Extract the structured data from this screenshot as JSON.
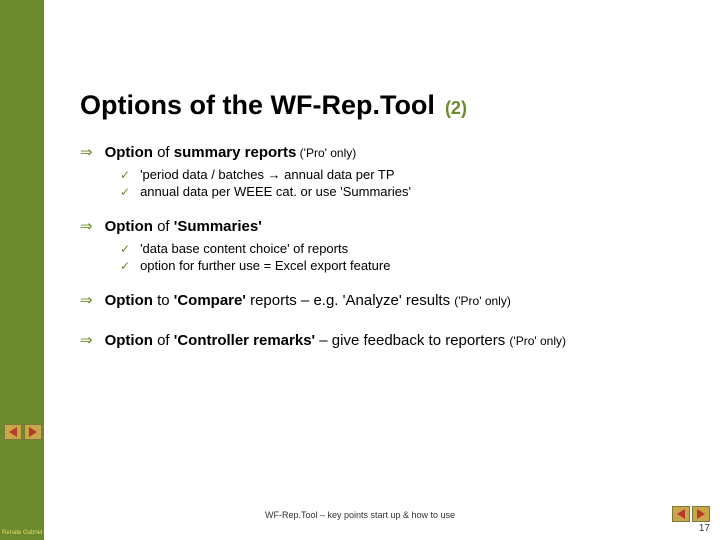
{
  "sidebar": {
    "author": "Renate Gabriel"
  },
  "title": {
    "main": "Options of the WF-Rep.Tool",
    "num": "(2)"
  },
  "bullets": {
    "b1": {
      "lead": "Option",
      "mid": " of ",
      "bold2": "summary reports",
      "tail": " ('Pro' only)"
    },
    "b1sub": {
      "a": "'period data / batches → annual data per TP",
      "b": "annual data per WEEE cat. or use 'Summaries'"
    },
    "b2": {
      "lead": "Option",
      "mid": " of ",
      "bold2": "'Summaries'"
    },
    "b2sub": {
      "a": "'data base content choice' of reports",
      "b": "option for further use = Excel export feature"
    },
    "b3": {
      "lead": "Option",
      "mid": " to ",
      "bold2": "'Compare'",
      "rest": "  reports – e.g. 'Analyze' results ",
      "tail": "('Pro' only)"
    },
    "b4": {
      "lead": "Option",
      "mid": " of ",
      "bold2": "'Controller remarks'",
      "rest": " – give feedback to reporters ",
      "tail": "('Pro' only)"
    }
  },
  "footer": {
    "text": "WF-Rep.Tool – key points start up & how to use",
    "page": "17"
  },
  "glyphs": {
    "arrow": "⇒",
    "check": "✓"
  }
}
